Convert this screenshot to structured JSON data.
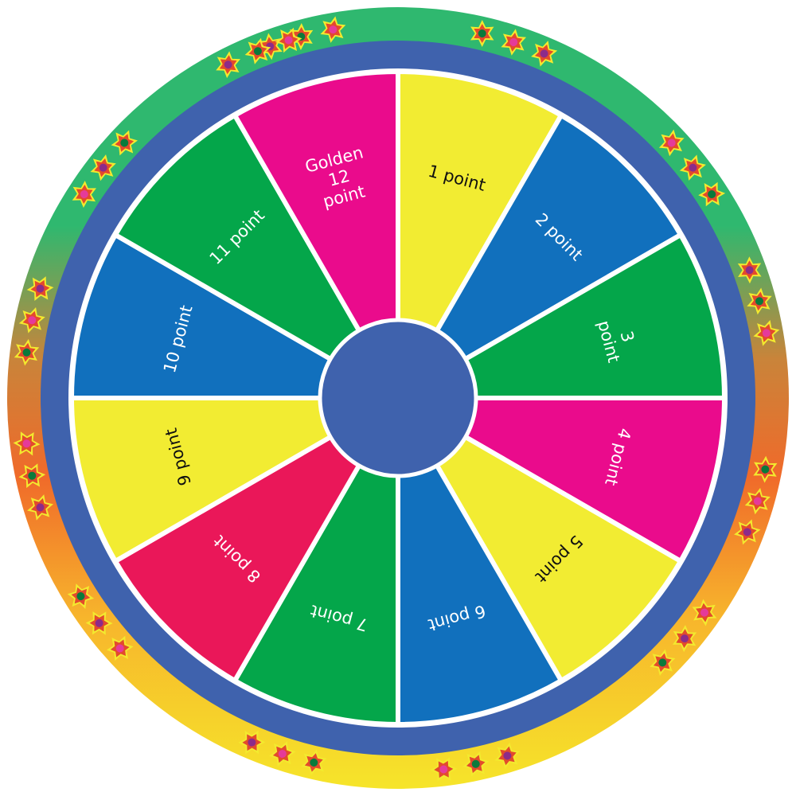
{
  "wheel": {
    "segments": [
      {
        "lines": [
          "1 point"
        ],
        "color": "#f2ec32",
        "text_color": "#111111"
      },
      {
        "lines": [
          "2 point"
        ],
        "color": "#1170bd",
        "text_color": "#ffffff"
      },
      {
        "lines": [
          "3",
          "point"
        ],
        "color": "#04a64a",
        "text_color": "#ffffff"
      },
      {
        "lines": [
          "4 point"
        ],
        "color": "#ea0b8c",
        "text_color": "#ffffff"
      },
      {
        "lines": [
          "5 point"
        ],
        "color": "#f2ec32",
        "text_color": "#111111"
      },
      {
        "lines": [
          "6 point"
        ],
        "color": "#1170bd",
        "text_color": "#ffffff"
      },
      {
        "lines": [
          "7 point"
        ],
        "color": "#04a64a",
        "text_color": "#ffffff"
      },
      {
        "lines": [
          "8 point"
        ],
        "color": "#ea1759",
        "text_color": "#ffffff"
      },
      {
        "lines": [
          "9 point"
        ],
        "color": "#f2ec32",
        "text_color": "#111111"
      },
      {
        "lines": [
          "10 point"
        ],
        "color": "#1170bd",
        "text_color": "#ffffff"
      },
      {
        "lines": [
          "11 point"
        ],
        "color": "#04a64a",
        "text_color": "#ffffff"
      },
      {
        "lines": [
          "Golden",
          "12",
          "point"
        ],
        "color": "#ea0b8c",
        "text_color": "#ffffff"
      }
    ],
    "colors": {
      "rim": "#3f62ad",
      "hub": "#3f62ad",
      "divider": "#ffffff",
      "outer_ring_top": "#2fb86f",
      "outer_ring_side": "#f06a2a",
      "outer_ring_bottom": "#f6e52a",
      "star_outer": "#f3ea2e",
      "star_mid": "#e34a2c",
      "star_inner": "#8c2b8a",
      "star_dot": "#e53a9a"
    },
    "star_icon": "star-decoration-icon"
  }
}
